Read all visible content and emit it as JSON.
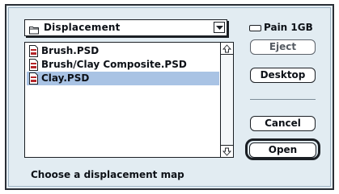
{
  "folder_popup": {
    "label": "Displacement",
    "icon": "folder-icon"
  },
  "files": [
    {
      "name": "Brush.PSD",
      "icon": "psd-document-icon",
      "selected": false
    },
    {
      "name": "Brush/Clay Composite.PSD",
      "icon": "psd-document-icon",
      "selected": false
    },
    {
      "name": "Clay.PSD",
      "icon": "psd-document-icon",
      "selected": true
    }
  ],
  "disk": {
    "label": "Pain 1GB",
    "icon": "hard-disk-icon"
  },
  "buttons": {
    "eject": "Eject",
    "desktop": "Desktop",
    "cancel": "Cancel",
    "open": "Open"
  },
  "prompt": "Choose a displacement map",
  "colors": {
    "selection": "#a9c3e4",
    "dialog_background": "#e2ecf2",
    "document_icon_red": "#b4262a"
  }
}
